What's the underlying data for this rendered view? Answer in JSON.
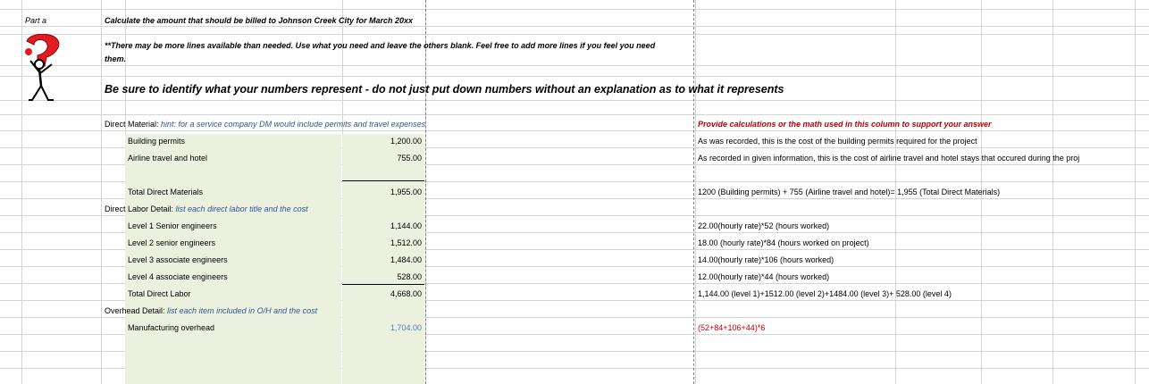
{
  "header": {
    "part": "Part a",
    "instruction": "Calculate the amount that should be billed to Johnson Creek City for March 20xx",
    "note_line1": "**There may be more lines available than needed.  Use what you need and leave the others blank.  Feel free to add more lines if you feel you need",
    "note_line2": "them.",
    "emphasis": "Be sure to identify what your numbers represent - do not just put down numbers without an explanation as to what it represents"
  },
  "calc_header": "Provide calculations or the math used in this column to support your answer",
  "direct_material": {
    "label": "Direct Material: ",
    "hint": "hint: for a service company DM would include permits and travel expenses",
    "rows": [
      {
        "name": "Building permits",
        "amount": "1,200.00",
        "calc": "As was recorded, this is the cost of the building permits required for the project"
      },
      {
        "name": "Airline travel and hotel",
        "amount": "755.00",
        "calc": "As recorded in given information, this is the cost of airline travel and hotel stays that occured during the proj"
      }
    ],
    "total": {
      "name": "Total Direct Materials",
      "amount": "1,955.00",
      "calc": "1200 (Building permits) + 755 (Airline travel and hotel)= 1,955 (Total Direct Materials)"
    }
  },
  "direct_labor": {
    "label": "Direct Labor Detail: ",
    "hint": "list each direct labor title and the cost",
    "rows": [
      {
        "name": "Level 1 Senior engineers",
        "amount": "1,144.00",
        "calc": "22.00(hourly rate)*52 (hours worked)"
      },
      {
        "name": "Level 2 senior engineers",
        "amount": "1,512.00",
        "calc": "18.00 (hourly rate)*84 (hours worked on project)"
      },
      {
        "name": "Level 3 associate engineers",
        "amount": "1,484.00",
        "calc": "14.00(hourly rate)*106 (hours worked)"
      },
      {
        "name": "Level 4 associate engineers",
        "amount": "528.00",
        "calc": "12.00(hourly rate)*44 (hours worked)"
      }
    ],
    "total": {
      "name": "Total Direct Labor",
      "amount": "4,668.00",
      "calc": "1,144.00 (level 1)+1512.00 (level 2)+1484.00 (level 3)+ 528.00 (level 4)"
    }
  },
  "overhead": {
    "label": "Overhead Detail: ",
    "hint": "list each item included in O/H and the cost",
    "rows": [
      {
        "name": "Manufacturing overhead",
        "amount": "1,704.00",
        "calc": "(52+84+106+44)*6"
      }
    ]
  },
  "colors": {
    "grid": "#d4d4d4",
    "green_fill": "#ebf1de",
    "hint_blue": "#2f5597",
    "red": "#c00000",
    "amount_blue": "#4f81bd"
  }
}
